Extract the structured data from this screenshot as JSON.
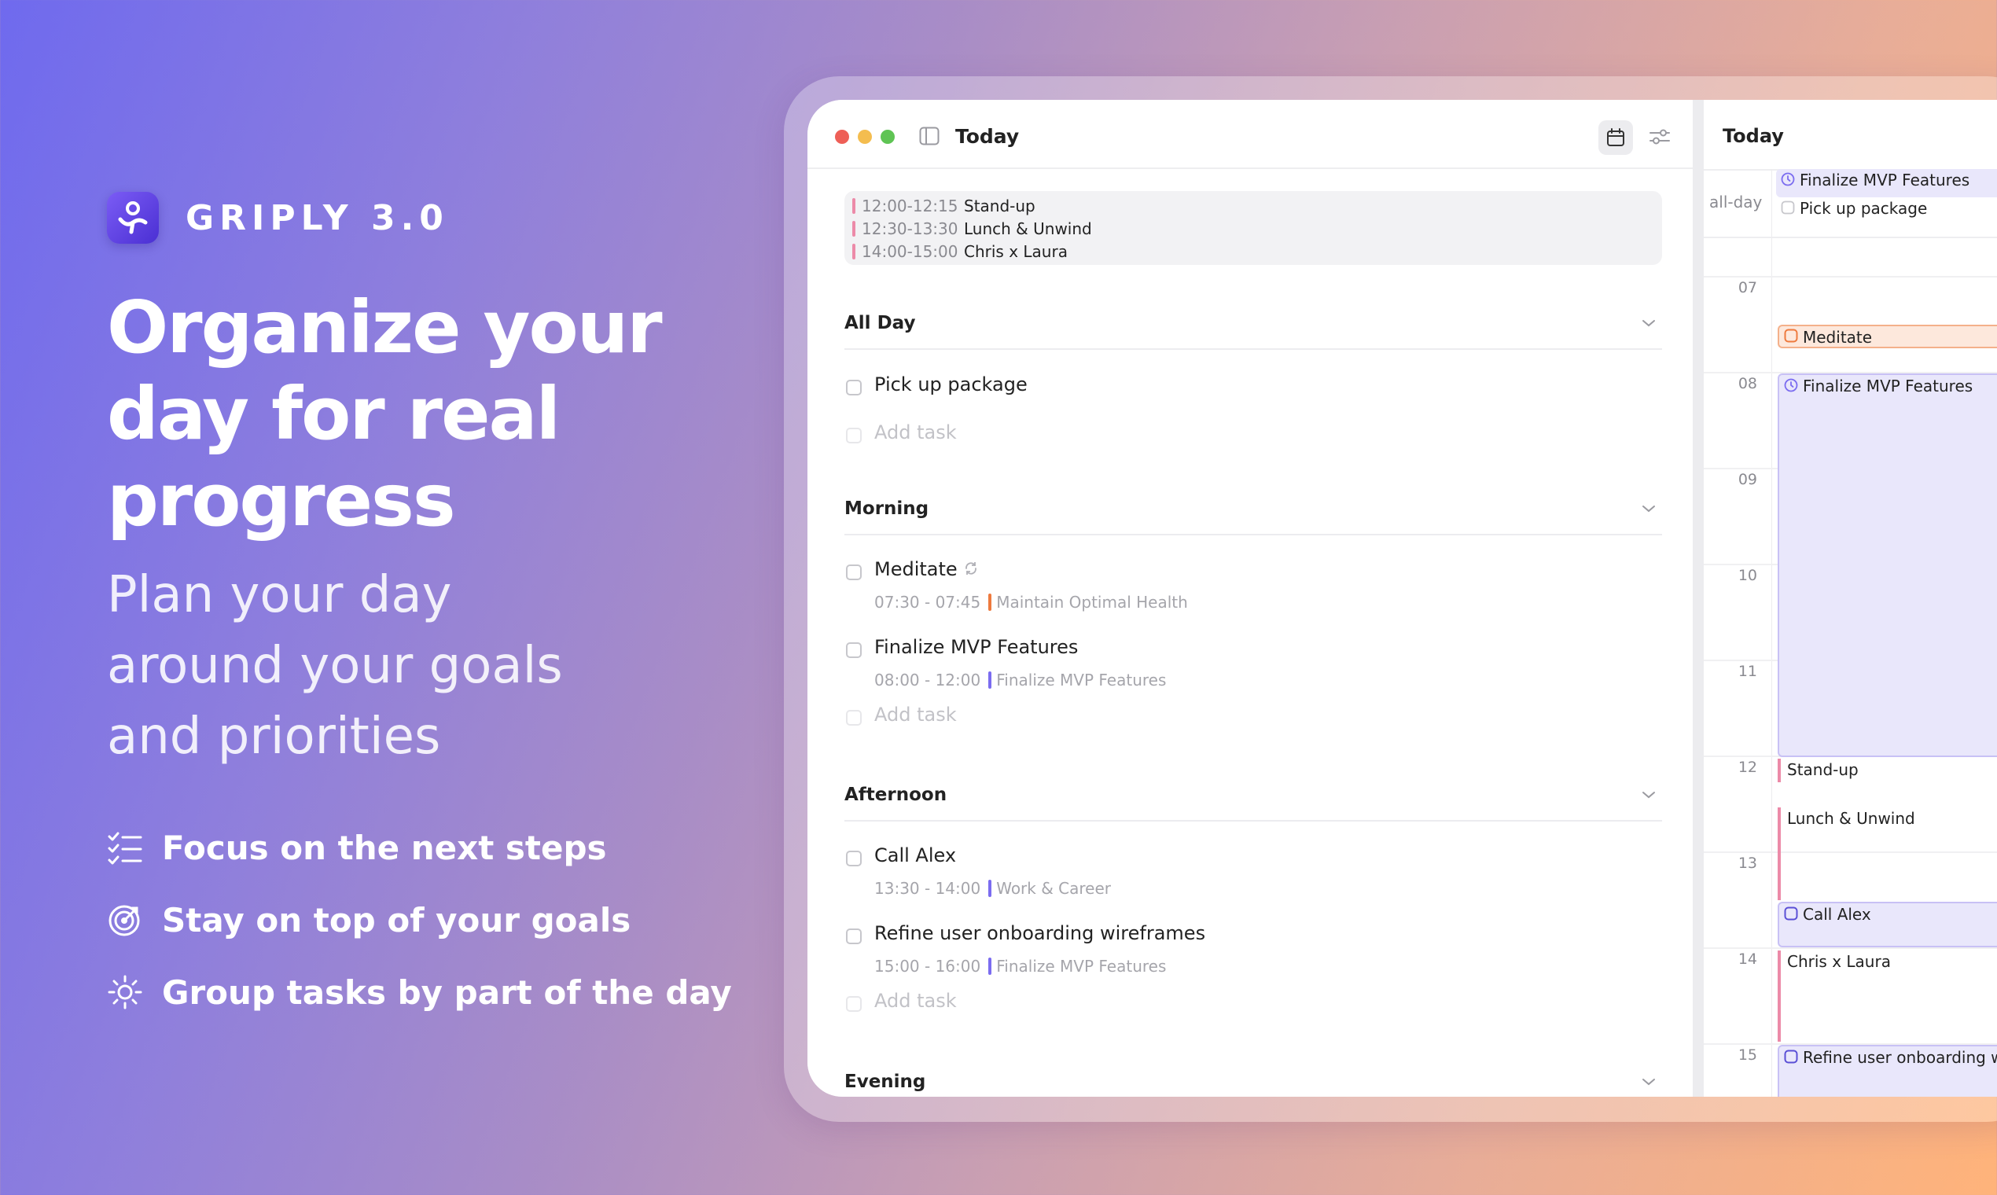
{
  "brand": {
    "name": "GRIPLY 3.0",
    "logo_icon": "griply-logo-icon"
  },
  "headline": [
    "Organize your",
    "day for real",
    "progress"
  ],
  "subhead": [
    "Plan your day",
    "around your goals",
    "and priorities"
  ],
  "features": [
    {
      "icon": "checklist-icon",
      "label": "Focus on the next steps"
    },
    {
      "icon": "target-icon",
      "label": "Stay on top of your goals"
    },
    {
      "icon": "sun-icon",
      "label": "Group tasks by part of the day"
    }
  ],
  "colors": {
    "accent": "#7b6cf0",
    "event_pink": "#ec8aa8",
    "health_orange": "#ee7a3e",
    "calendar_violet_bg": "#e9e7fb",
    "calendar_orange_bg": "#fde8dc"
  },
  "app": {
    "window_title": "Today",
    "today_events": [
      {
        "time": "12:00-12:15",
        "name": "Stand-up"
      },
      {
        "time": "12:30-13:30",
        "name": "Lunch & Unwind"
      },
      {
        "time": "14:00-15:00",
        "name": "Chris x Laura"
      }
    ],
    "add_task_label": "Add task",
    "sections": {
      "all_day": {
        "title": "All Day",
        "tasks": [
          {
            "name": "Pick up package"
          }
        ]
      },
      "morning": {
        "title": "Morning",
        "tasks": [
          {
            "name": "Meditate",
            "time": "07:30 - 07:45",
            "goal": "Maintain Optimal Health"
          },
          {
            "name": "Finalize MVP Features",
            "time": "08:00 - 12:00",
            "goal": "Finalize MVP Features"
          }
        ]
      },
      "afternoon": {
        "title": "Afternoon",
        "tasks": [
          {
            "name": "Call Alex",
            "time": "13:30 - 14:00",
            "goal": "Work & Career"
          },
          {
            "name": "Refine user onboarding wireframes",
            "time": "15:00 - 16:00",
            "goal": "Finalize MVP Features"
          }
        ]
      },
      "evening": {
        "title": "Evening"
      }
    }
  },
  "calendar": {
    "title": "Today",
    "all_day_label": "all-day",
    "all_day_events": [
      "Finalize MVP Features",
      "Pick up package"
    ],
    "hours": [
      "07",
      "08",
      "09",
      "10",
      "11",
      "12",
      "13",
      "14",
      "15"
    ],
    "events": {
      "meditate": "Meditate",
      "finalize": "Finalize MVP Features",
      "standup": "Stand-up",
      "lunch": "Lunch & Unwind",
      "call_alex": "Call Alex",
      "chris_laura": "Chris x Laura",
      "refine": "Refine user onboarding wireframes"
    }
  }
}
